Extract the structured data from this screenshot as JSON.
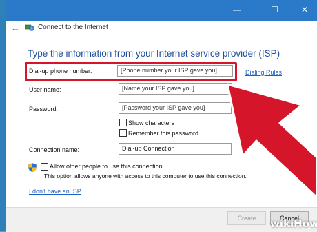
{
  "window": {
    "title": "Connect to the Internet",
    "controls": {
      "minimize": "—",
      "maximize": "☐",
      "close": "✕"
    }
  },
  "nav": {
    "back_glyph": "←"
  },
  "heading": "Type the information from your Internet service provider (ISP)",
  "form": {
    "phone": {
      "label": "Dial-up phone number:",
      "value": "[Phone number your ISP gave you]"
    },
    "dialing_rules": "Dialing Rules",
    "user": {
      "label": "User name:",
      "value": "[Name your ISP gave you]"
    },
    "password": {
      "label": "Password:",
      "value": "[Password your ISP gave you]"
    },
    "show_characters": "Show characters",
    "remember_password": "Remember this password",
    "connection": {
      "label": "Connection name:",
      "value": "Dial-up Connection"
    },
    "allow_others": "Allow other people to use this connection",
    "allow_note": "This option allows anyone with access to this computer to use this connection."
  },
  "no_isp_link": "I don't have an ISP",
  "buttons": {
    "create": "Create",
    "cancel": "Cancel"
  },
  "watermark": "wikiHow",
  "colors": {
    "accent": "#2b79c9",
    "highlight": "#d5162a",
    "heading": "#1f4e9b"
  }
}
